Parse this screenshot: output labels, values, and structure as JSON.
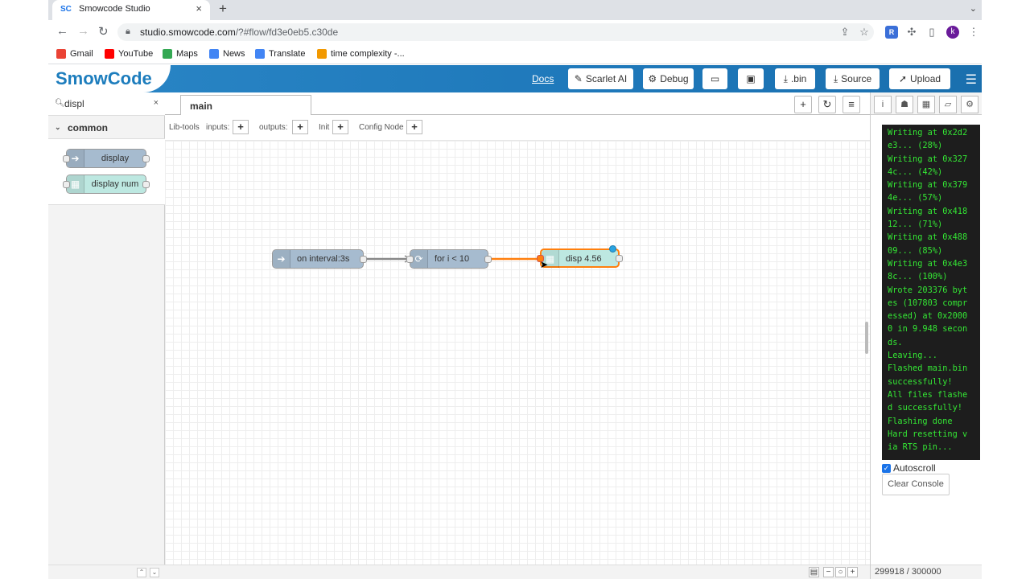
{
  "browser": {
    "tab_favicon": "SC",
    "tab_title": "Smowcode Studio",
    "tab_close": "×",
    "new_tab": "+",
    "url_host": "studio.smowcode.com",
    "url_path": "/?#flow/fd3e0eb5.c30de",
    "bookmarks": [
      {
        "label": "Gmail",
        "color": "#ea4335"
      },
      {
        "label": "YouTube",
        "color": "#ff0000"
      },
      {
        "label": "Maps",
        "color": "#34a853"
      },
      {
        "label": "News",
        "color": "#4285f4"
      },
      {
        "label": "Translate",
        "color": "#4285f4"
      },
      {
        "label": "time complexity -...",
        "color": "#f29900"
      }
    ],
    "avatar_letter": "k",
    "ext_badge": "R"
  },
  "header": {
    "logo": "SmowCode",
    "docs": "Docs",
    "scarlet": "Scarlet AI",
    "debug": "Debug",
    "bin": ".bin",
    "source": "Source",
    "upload": "Upload"
  },
  "palette": {
    "search_value": "displ",
    "category": "common",
    "nodes": [
      {
        "label": "display",
        "color": "#a6bbcf"
      },
      {
        "label": "display num",
        "color": "#bde8e1"
      }
    ]
  },
  "workspace": {
    "tab_label": "main",
    "subbar": {
      "libtools": "Lib-tools",
      "inputs": "inputs:",
      "outputs": "outputs:",
      "init": "Init",
      "config": "Config Node"
    },
    "nodes": [
      {
        "label": "on interval:3s",
        "color": "#a6bbcf"
      },
      {
        "label": "for i < 10",
        "color": "#a6bbcf"
      },
      {
        "label": "disp 4.56",
        "color": "#bde8e1"
      }
    ]
  },
  "sidebar": {
    "console_lines": [
      "Writing at 0x2d2",
      "e3... (28%)",
      "Writing at 0x327",
      "4c... (42%)",
      "Writing at 0x379",
      "4e... (57%)",
      "Writing at 0x418",
      "12... (71%)",
      "Writing at 0x488",
      "09... (85%)",
      "Writing at 0x4e3",
      "8c... (100%)",
      "Wrote 203376 byt",
      "es (107803 compr",
      "essed) at 0x2000",
      "0 in 9.948 secon",
      "ds.",
      "Leaving...",
      "Flashed main.bin",
      "successfully!",
      "All files flashe",
      "d successfully!",
      "Flashing done",
      "Hard resetting v",
      "ia RTS pin..."
    ],
    "autoscroll_label": "Autoscroll",
    "clear_label": "Clear Console",
    "memory": "299918 / 300000"
  }
}
